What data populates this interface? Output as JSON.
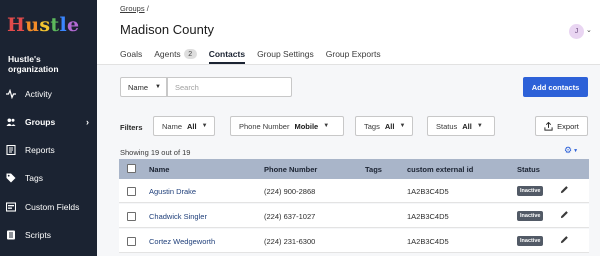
{
  "sidebar": {
    "logo": "Hustle",
    "logo_colors": [
      "#e24b4b",
      "#f28c28",
      "#f4c430",
      "#5cb85c",
      "#3a86ff",
      "#b46ad4"
    ],
    "org_name": "Hustle's organization",
    "items": [
      {
        "label": "Activity",
        "icon": "activity-icon"
      },
      {
        "label": "Groups",
        "icon": "groups-icon",
        "active": true
      },
      {
        "label": "Reports",
        "icon": "reports-icon"
      },
      {
        "label": "Tags",
        "icon": "tag-icon"
      },
      {
        "label": "Custom Fields",
        "icon": "custom-fields-icon"
      },
      {
        "label": "Scripts",
        "icon": "scripts-icon"
      }
    ]
  },
  "header": {
    "breadcrumb_link": "Groups",
    "breadcrumb_sep": "/",
    "title": "Madison County",
    "avatar_initial": "J"
  },
  "tabs": [
    {
      "label": "Goals"
    },
    {
      "label": "Agents",
      "badge": "2"
    },
    {
      "label": "Contacts",
      "active": true
    },
    {
      "label": "Group Settings"
    },
    {
      "label": "Group Exports"
    }
  ],
  "search": {
    "field_select": "Name",
    "placeholder": "Search",
    "add_button": "Add contacts"
  },
  "filters": {
    "label": "Filters",
    "items": [
      {
        "name": "Name",
        "value": "All"
      },
      {
        "name": "Phone Number",
        "value": "Mobile"
      },
      {
        "name": "Tags",
        "value": "All"
      },
      {
        "name": "Status",
        "value": "All"
      }
    ],
    "export_label": "Export"
  },
  "showing": "Showing 19 out of 19",
  "accent_color": "#2d61d8",
  "table": {
    "columns": [
      "Name",
      "Phone Number",
      "Tags",
      "custom external id",
      "Status"
    ],
    "rows": [
      {
        "name": "Agustin Drake",
        "phone": "(224) 900-2868",
        "tags": "",
        "external_id": "1A2B3C4D5",
        "status": "Inactive"
      },
      {
        "name": "Chadwick Singler",
        "phone": "(224) 637-1027",
        "tags": "",
        "external_id": "1A2B3C4D5",
        "status": "Inactive"
      },
      {
        "name": "Cortez Wedgeworth",
        "phone": "(224) 231-6300",
        "tags": "",
        "external_id": "1A2B3C4D5",
        "status": "Inactive"
      }
    ]
  }
}
